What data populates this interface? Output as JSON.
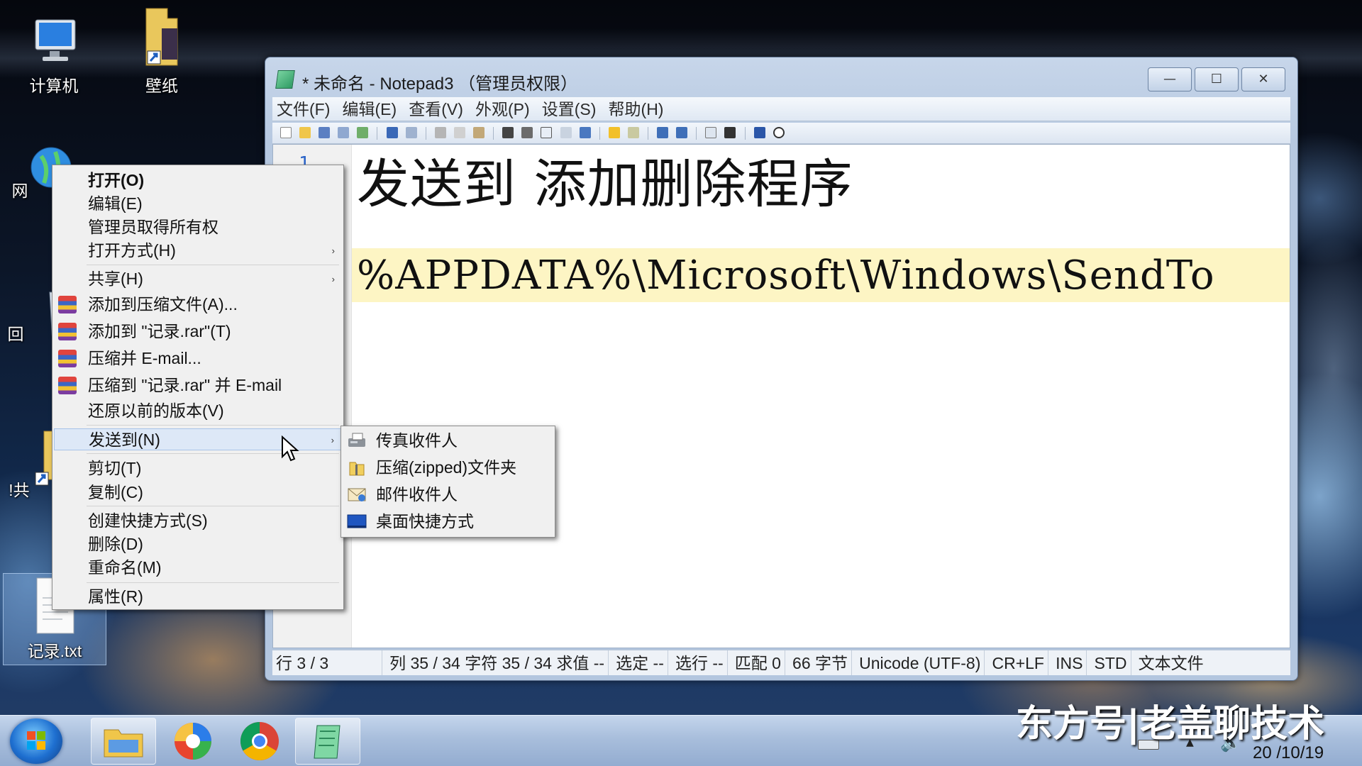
{
  "desktop": {
    "icons": [
      {
        "label": "计算机"
      },
      {
        "label": "壁纸"
      },
      {
        "label": "网"
      },
      {
        "label": "回"
      },
      {
        "label": "!共"
      },
      {
        "label": "记录.txt"
      }
    ]
  },
  "window": {
    "title": "* 未命名 - Notepad3 （管理员权限）",
    "controls": {
      "minimize": "—",
      "maximize": "☐",
      "close": "✕"
    },
    "menu": [
      "文件(F)",
      "编辑(E)",
      "查看(V)",
      "外观(P)",
      "设置(S)",
      "帮助(H)"
    ],
    "editor": {
      "line_number": "1",
      "line1": "发送到 添加删除程序",
      "line3": "%APPDATA%\\Microsoft\\Windows\\SendTo"
    },
    "status": [
      "行 3 / 3",
      "列 35 / 34 字符 35 / 34 求值 --",
      "选定 --",
      "选行 --",
      "匹配 0",
      "66 字节",
      "Unicode (UTF-8)",
      "CR+LF",
      "INS",
      "STD",
      "文本文件"
    ]
  },
  "context_menu": {
    "items": [
      {
        "label": "打开(O)"
      },
      {
        "label": "编辑(E)"
      },
      {
        "label": "管理员取得所有权"
      },
      {
        "label": "打开方式(H)"
      },
      {
        "label": "共享(H)"
      },
      {
        "label": "添加到压缩文件(A)..."
      },
      {
        "label": "添加到 \"记录.rar\"(T)"
      },
      {
        "label": "压缩并 E-mail..."
      },
      {
        "label": "压缩到 \"记录.rar\" 并 E-mail"
      },
      {
        "label": "还原以前的版本(V)"
      },
      {
        "label": "发送到(N)"
      },
      {
        "label": "剪切(T)"
      },
      {
        "label": "复制(C)"
      },
      {
        "label": "创建快捷方式(S)"
      },
      {
        "label": "删除(D)"
      },
      {
        "label": "重命名(M)"
      },
      {
        "label": "属性(R)"
      }
    ],
    "arrow": "›"
  },
  "send_to_submenu": {
    "items": [
      {
        "label": "传真收件人",
        "icon": "fax-icon"
      },
      {
        "label": "压缩(zipped)文件夹",
        "icon": "zip-folder-icon"
      },
      {
        "label": "邮件收件人",
        "icon": "mail-icon"
      },
      {
        "label": "桌面快捷方式",
        "icon": "desktop-icon"
      }
    ]
  },
  "watermark": "东方号|老盖聊技术",
  "clock": "20 /10/19",
  "colors": {
    "editor_highlight": "#fdf5c4",
    "line_number": "#2b64c8",
    "menu_highlight": "#dde8f7"
  }
}
